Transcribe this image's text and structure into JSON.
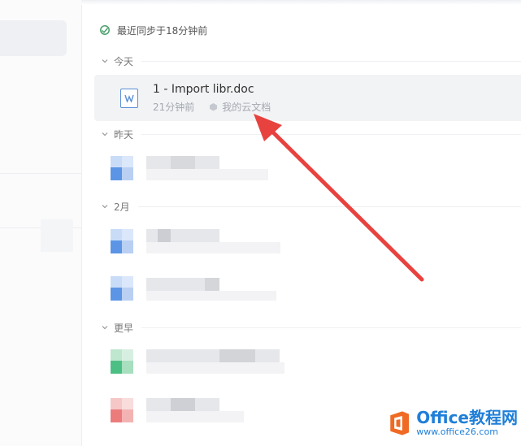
{
  "sync": {
    "text": "最近同步于18分钟前",
    "icon": "sync-icon"
  },
  "groups": [
    {
      "label": "今天"
    },
    {
      "label": "昨天"
    },
    {
      "label": "2月"
    },
    {
      "label": "更早"
    }
  ],
  "recent_file": {
    "name": "1 - Import libr.doc",
    "time": "21分钟前",
    "location": "我的云文档",
    "icon": "word-doc-icon"
  },
  "watermark": {
    "brand": "Office教程网",
    "url": "www.office26.com"
  },
  "colors": {
    "accent": "#1f7fd8",
    "arrow": "#e8423f",
    "selected_row": "#f2f3f5"
  }
}
